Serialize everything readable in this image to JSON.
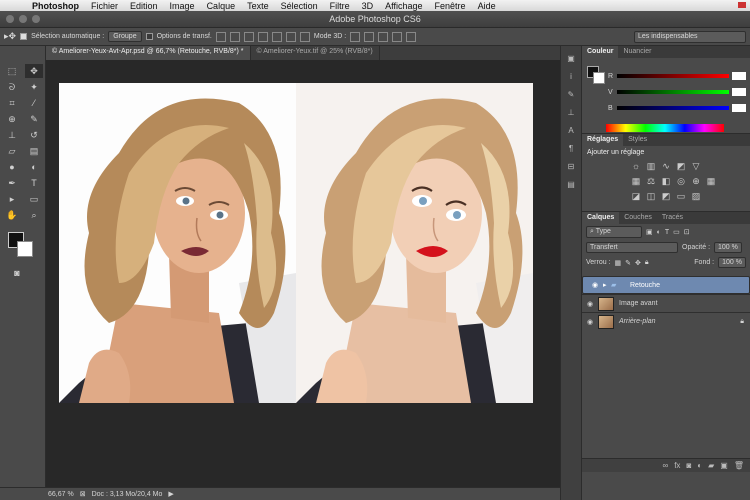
{
  "menubar": {
    "items": [
      "Photoshop",
      "Fichier",
      "Edition",
      "Image",
      "Calque",
      "Texte",
      "Sélection",
      "Filtre",
      "3D",
      "Affichage",
      "Fenêtre",
      "Aide"
    ]
  },
  "titlebar": {
    "title": "Adobe Photoshop CS6"
  },
  "options": {
    "auto_select_label": "Sélection automatique :",
    "auto_select_value": "Groupe",
    "transform_label": "Options de transf.",
    "mode3d_label": "Mode 3D :",
    "workspace": "Les indispensables"
  },
  "tabs": [
    {
      "label": "© Ameliorer-Yeux-Avt-Apr.psd @ 66,7% (Retouche, RVB/8*) *"
    },
    {
      "label": "© Ameliorer-Yeux.tif @ 25% (RVB/8*)"
    }
  ],
  "status": {
    "zoom": "66,67 %",
    "doc": "Doc : 3,13 Mo/20,4 Mo"
  },
  "color_panel": {
    "tabs": [
      "Couleur",
      "Nuancier"
    ],
    "channels": [
      "R",
      "V",
      "B"
    ]
  },
  "adjust_panel": {
    "tabs": [
      "Réglages",
      "Styles"
    ],
    "title": "Ajouter un réglage"
  },
  "layers_panel": {
    "tabs": [
      "Calques",
      "Couches",
      "Tracés"
    ],
    "filter": "Type",
    "blend_mode": "Transfert",
    "opacity_label": "Opacité :",
    "opacity_value": "100 %",
    "lock_label": "Verrou :",
    "fill_label": "Fond :",
    "fill_value": "100 %",
    "layers": [
      {
        "name": "Retouche",
        "kind": "folder"
      },
      {
        "name": "Image avant",
        "kind": "image"
      },
      {
        "name": "Arrière-plan",
        "kind": "image"
      }
    ]
  },
  "colors": {
    "accent_selection": "#6e89b0",
    "ui_dark": "#4a4a4a",
    "canvas_bg": "#282828"
  }
}
